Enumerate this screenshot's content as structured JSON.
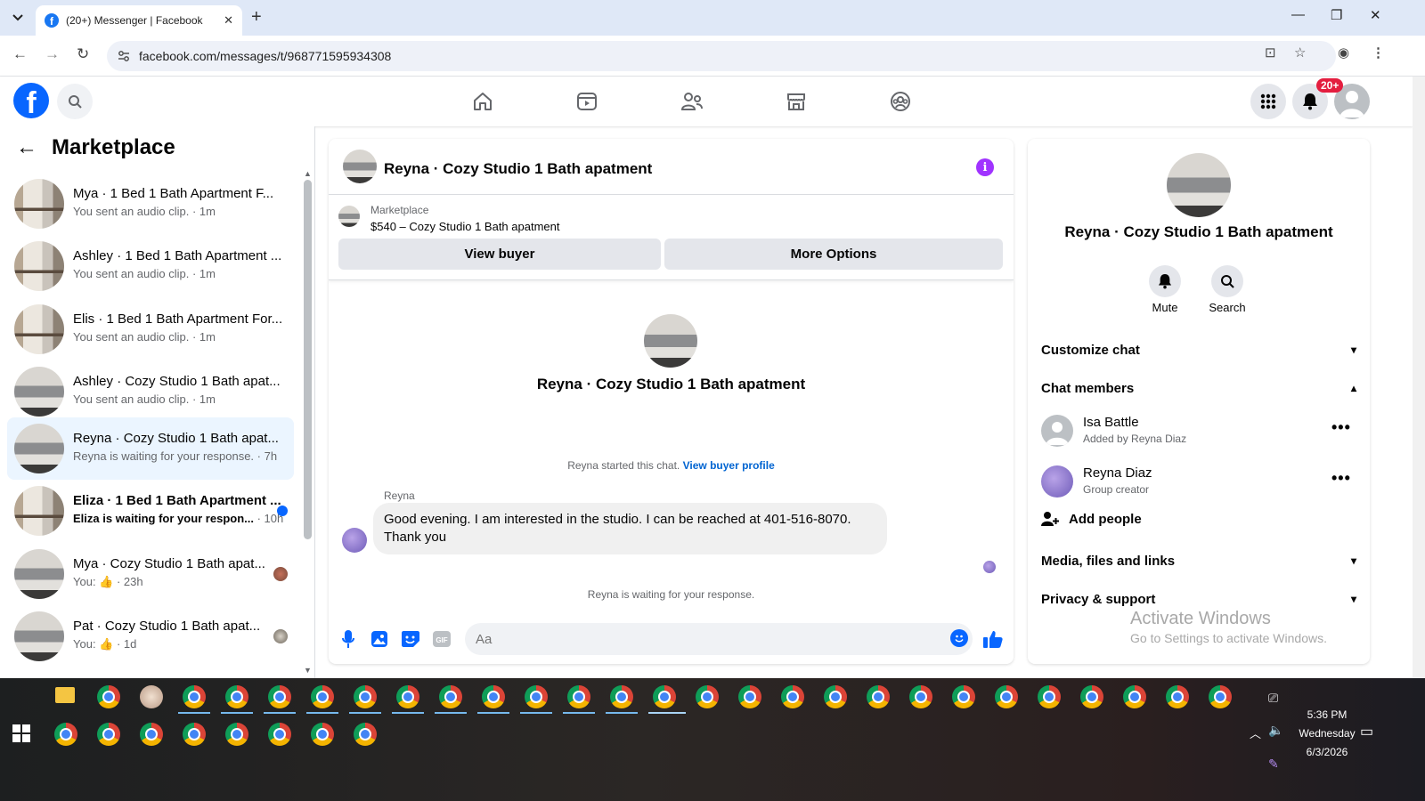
{
  "browser": {
    "tab_title": "(20+) Messenger | Facebook",
    "url": "facebook.com/messages/t/968771595934308"
  },
  "fb": {
    "notification_badge": "20+",
    "brand_color": "#0866ff"
  },
  "sidebar": {
    "title": "Marketplace",
    "conversations": [
      {
        "name": "Mya · 1 Bed 1 Bath Apartment F...",
        "sub": "You sent an audio clip. · 1m",
        "bold": false,
        "active": false
      },
      {
        "name": "Ashley · 1 Bed 1 Bath Apartment ...",
        "sub": "You sent an audio clip. · 1m",
        "bold": false,
        "active": false
      },
      {
        "name": "Elis · 1 Bed 1 Bath Apartment For...",
        "sub": "You sent an audio clip. · 1m",
        "bold": false,
        "active": false
      },
      {
        "name": "Ashley · Cozy Studio 1 Bath apat...",
        "sub": "You sent an audio clip. · 1m",
        "bold": false,
        "active": false
      },
      {
        "name": "Reyna · Cozy Studio 1 Bath apat...",
        "sub": "Reyna is waiting for your response. · 7h",
        "bold": false,
        "active": true
      },
      {
        "name": "Eliza · 1 Bed 1 Bath Apartment ...",
        "sub_a": "Eliza is waiting for your respon...",
        "sub_b": " · 10h",
        "bold": true,
        "active": false
      },
      {
        "name": "Mya · Cozy Studio 1 Bath apat...",
        "sub_a": "You:",
        "sub_b": " · 23h",
        "bold": false,
        "active": false
      },
      {
        "name": "Pat · Cozy Studio 1 Bath apat...",
        "sub_a": "You:",
        "sub_b": " · 1d",
        "bold": false,
        "active": false
      }
    ]
  },
  "chat": {
    "header_name": "Reyna · Cozy Studio 1 Bath apatment",
    "marketplace_label": "Marketplace",
    "listing": "$540 – Cozy Studio 1 Bath apatment",
    "view_buyer": "View buyer",
    "more_options": "More Options",
    "convo_name": "Reyna · Cozy Studio 1 Bath apatment",
    "started_text": "Reyna started this chat.",
    "view_profile": "View buyer profile",
    "sender": "Reyna",
    "message": "Good evening. I am interested in the studio. I can be reached at 401-516-8070. Thank you",
    "waiting": "Reyna is waiting for your response.",
    "composer_placeholder": "Aa"
  },
  "info": {
    "title": "Reyna · Cozy Studio 1 Bath apatment",
    "mute": "Mute",
    "search": "Search",
    "customize": "Customize chat",
    "members_heading": "Chat members",
    "members": [
      {
        "name": "Isa Battle",
        "role": "Added by Reyna Diaz"
      },
      {
        "name": "Reyna Diaz",
        "role": "Group creator"
      }
    ],
    "add_people": "Add people",
    "media": "Media, files and links",
    "privacy": "Privacy & support"
  },
  "watermark": {
    "line1": "Activate Windows",
    "line2": "Go to Settings to activate Windows."
  },
  "taskbar": {
    "time": "5:36 PM",
    "day": "Wednesday",
    "date": "6/3/2026"
  }
}
